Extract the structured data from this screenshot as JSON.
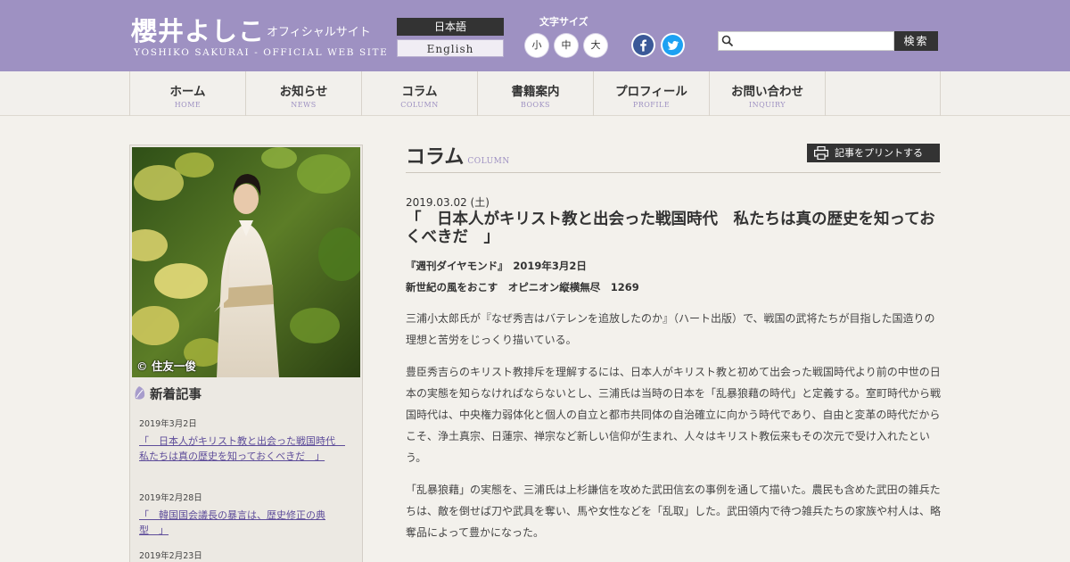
{
  "header": {
    "logo_main": "櫻井よしこ",
    "logo_sub": "オフィシャルサイト",
    "logo_en": "YOSHIKO SAKURAI - OFFICIAL WEB SITE",
    "lang_jp": "日本語",
    "lang_en": "English",
    "font_size_label": "文字サイズ",
    "font_small": "小",
    "font_medium": "中",
    "font_large": "大",
    "social": [
      "facebook-icon",
      "twitter-icon"
    ],
    "search_placeholder": "",
    "search_button": "検索",
    "colors": {
      "header_bg": "#9e91c2",
      "facebook": "#3b5998",
      "twitter": "#1da1f2"
    }
  },
  "nav": [
    {
      "ja": "ホーム",
      "en": "HOME"
    },
    {
      "ja": "お知らせ",
      "en": "NEWS"
    },
    {
      "ja": "コラム",
      "en": "COLUMN"
    },
    {
      "ja": "書籍案内",
      "en": "BOOKS"
    },
    {
      "ja": "プロフィール",
      "en": "PROFILE"
    },
    {
      "ja": "お問い合わせ",
      "en": "INQUIRY"
    }
  ],
  "sidebar": {
    "photo_credit": "© 住友一俊",
    "news_title": "新着記事",
    "news": [
      {
        "date": "2019年3月2日",
        "title": "「　日本人がキリスト教と出会った戦国時代　私たちは真の歴史を知っておくべきだ　」"
      },
      {
        "date": "2019年2月28日",
        "title": "「　韓国国会議長の暴言は、歴史修正の典型　」"
      },
      {
        "date": "2019年2月23日",
        "title": ""
      }
    ]
  },
  "main": {
    "section_title": "コラム",
    "section_title_en": "COLUMN",
    "print_button": "記事をプリントする",
    "article": {
      "date": "2019.03.02 (土)",
      "title": "「　日本人がキリスト教と出会った戦国時代　私たちは真の歴史を知っておくべきだ　」",
      "source1": "『週刊ダイヤモンド』　2019年3月2日",
      "source2": "新世紀の風をおこす　オピニオン縦横無尽　1269",
      "paragraphs": [
        "三浦小太郎氏が『なぜ秀吉はバテレンを追放したのか』（ハート出版）で、戦国の武将たちが目指した国造りの理想と苦労をじっくり描いている。",
        "豊臣秀吉らのキリスト教排斥を理解するには、日本人がキリスト教と初めて出会った戦国時代より前の中世の日本の実態を知らなければならないとし、三浦氏は当時の日本を「乱暴狼藉の時代」と定義する。室町時代から戦国時代は、中央権力弱体化と個人の自立と都市共同体の自治確立に向かう時代であり、自由と変革の時代だからこそ、浄土真宗、日蓮宗、禅宗など新しい信仰が生まれ、人々はキリスト教伝来もその次元で受け入れたという。",
        "「乱暴狼藉」の実態を、三浦氏は上杉謙信を攻めた武田信玄の事例を通して描いた。農民も含めた武田の雑兵たちは、敵を倒せば刀や武具を奪い、馬や女性などを「乱取」した。武田領内で待つ雑兵たちの家族や村人は、略奪品によって豊かになった。"
      ]
    }
  }
}
